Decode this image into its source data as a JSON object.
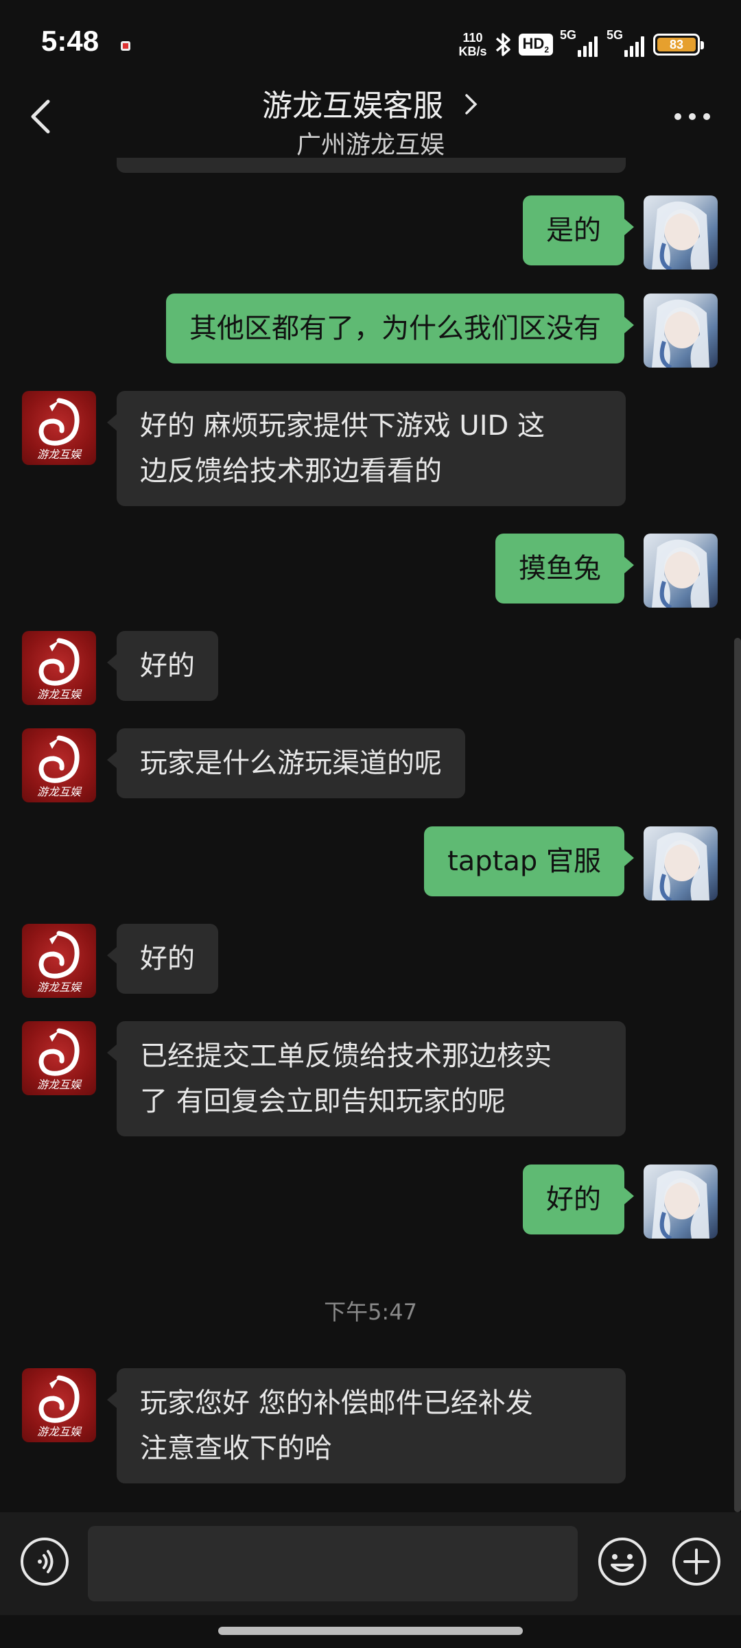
{
  "status_bar": {
    "time": "5:48",
    "net_speed_value": "110",
    "net_speed_unit": "KB/s",
    "hd_label": "HD",
    "hd_sub": "2",
    "sim1_label": "5G",
    "sim2_label": "5G",
    "battery_level": "83",
    "battery_color": "#e6a02e",
    "icons": [
      "notification-icon",
      "bluetooth-icon",
      "signal-icon",
      "battery-icon"
    ]
  },
  "header": {
    "title": "游龙互娱客服",
    "subtitle": "广州游龙互娱",
    "icons": [
      "back-icon",
      "chevron-right-icon",
      "more-icon"
    ]
  },
  "messages": [
    {
      "side": "out",
      "text": "是的"
    },
    {
      "side": "out",
      "text": "其他区都有了，为什么我们区没有"
    },
    {
      "side": "in",
      "lines": [
        "好的 麻烦玩家提供下游戏 UID 这",
        "边反馈给技术那边看看的"
      ]
    },
    {
      "side": "out",
      "text": "摸鱼兔"
    },
    {
      "side": "in",
      "text": "好的"
    },
    {
      "side": "in",
      "text": "玩家是什么游玩渠道的呢"
    },
    {
      "side": "out",
      "text": "taptap 官服"
    },
    {
      "side": "in",
      "text": "好的"
    },
    {
      "side": "in",
      "lines": [
        "已经提交工单反馈给技术那边核实",
        "了 有回复会立即告知玩家的呢"
      ]
    },
    {
      "side": "out",
      "text": "好的"
    },
    {
      "side": "in",
      "lines": [
        "玩家您好 您的补偿邮件已经补发",
        "注意查收下的哈"
      ]
    }
  ],
  "timestamp": "下午5:47",
  "cs_avatar_label": "游龙互娱",
  "input_bar": {
    "placeholder": "",
    "icons": [
      "voice-icon",
      "emoji-icon",
      "plus-icon"
    ]
  },
  "colors": {
    "background": "#111111",
    "incoming_bubble": "#2c2c2c",
    "outgoing_bubble": "#5fba73",
    "brand_red": "#b92a2a"
  }
}
